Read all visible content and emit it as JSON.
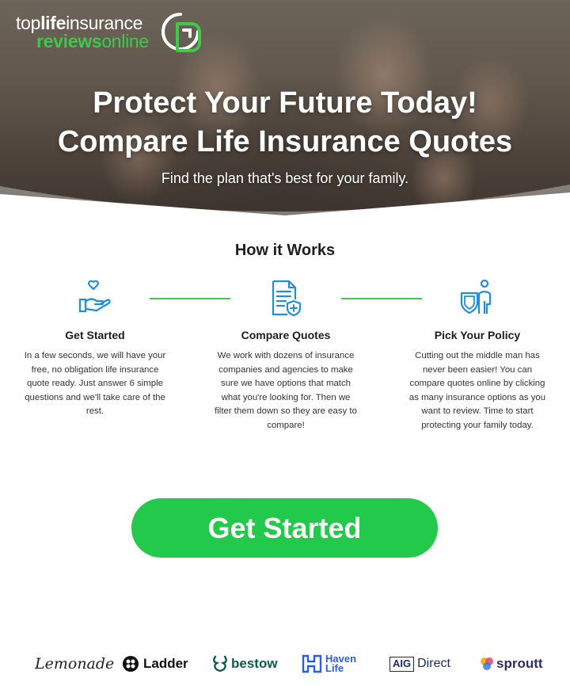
{
  "logo": {
    "line1_part1": "top",
    "line1_part2": "life",
    "line1_part3": "insurance",
    "line2_part1": "reviews",
    "line2_part2": "online"
  },
  "hero": {
    "title_line1": "Protect Your Future Today!",
    "title_line2": "Compare Life Insurance Quotes",
    "subtitle": "Find the plan that's best for your family."
  },
  "how_it_works": {
    "title": "How it Works",
    "steps": [
      {
        "icon": "heart-hand-icon",
        "title": "Get Started",
        "text": "In a few seconds, we will have your free, no obligation life insurance quote ready. Just answer 6 simple questions and we'll take care of the rest."
      },
      {
        "icon": "document-shield-icon",
        "title": "Compare Quotes",
        "text": "We work with dozens of insurance companies and agencies to make sure we have options that match what you're looking for. Then we filter them down so they are easy to compare!"
      },
      {
        "icon": "person-shield-icon",
        "title": "Pick Your Policy",
        "text": "Cutting out the middle man has never been easier! You can compare quotes online by clicking as many insurance options as you want to review. Time to start protecting your family today."
      }
    ]
  },
  "cta": {
    "label": "Get Started"
  },
  "partners": {
    "lemonade": "Lemonade",
    "ladder": "Ladder",
    "bestow": "bestow",
    "haven_line1": "Haven",
    "haven_line2": "Life",
    "aig_box": "AIG",
    "aig_text": "Direct",
    "sproutt": "sproutt"
  },
  "colors": {
    "brand_green": "#3dc94a",
    "cta_green": "#22c94a",
    "icon_blue": "#1f8ed8"
  }
}
